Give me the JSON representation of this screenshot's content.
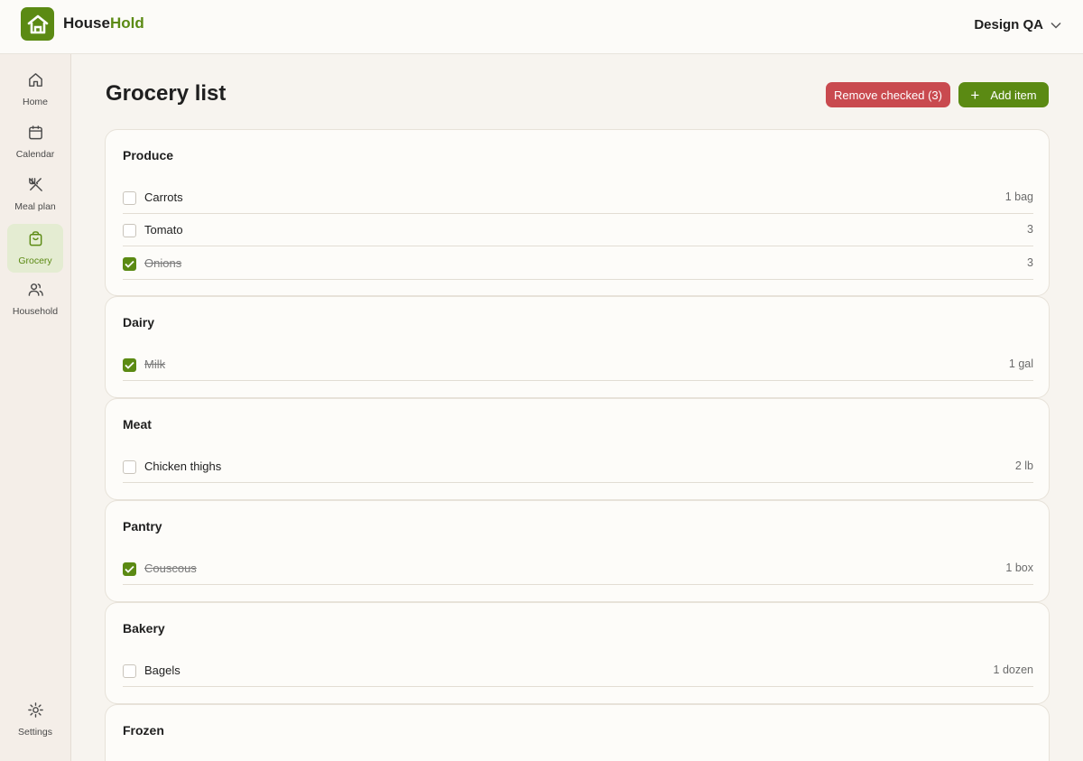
{
  "brand": {
    "name_part1": "House",
    "name_part2": "Hold"
  },
  "account": {
    "name": "Design QA"
  },
  "sidebar": {
    "items": [
      {
        "label": "Home",
        "icon": "home-icon"
      },
      {
        "label": "Calendar",
        "icon": "calendar-icon"
      },
      {
        "label": "Meal plan",
        "icon": "utensils-icon"
      },
      {
        "label": "Grocery",
        "icon": "shopping-bag-icon",
        "active": true
      },
      {
        "label": "Household",
        "icon": "users-icon"
      }
    ],
    "settings_label": "Settings"
  },
  "page": {
    "title": "Grocery list"
  },
  "actions": {
    "remove_checked": "Remove checked (3)",
    "add_item": "Add item"
  },
  "colors": {
    "accent": "#5b8a13",
    "danger": "#c94a4f",
    "active_bg": "#e4ecd2"
  },
  "categories": [
    {
      "name": "Produce",
      "items": [
        {
          "name": "Carrots",
          "qty": "1 bag",
          "checked": false
        },
        {
          "name": "Tomato",
          "qty": "3",
          "checked": false
        },
        {
          "name": "Onions",
          "qty": "3",
          "checked": true
        }
      ]
    },
    {
      "name": "Dairy",
      "items": [
        {
          "name": "Milk",
          "qty": "1 gal",
          "checked": true
        }
      ]
    },
    {
      "name": "Meat",
      "items": [
        {
          "name": "Chicken thighs",
          "qty": "2 lb",
          "checked": false
        }
      ]
    },
    {
      "name": "Pantry",
      "items": [
        {
          "name": "Couscous",
          "qty": "1 box",
          "checked": true
        }
      ]
    },
    {
      "name": "Bakery",
      "items": [
        {
          "name": "Bagels",
          "qty": "1 dozen",
          "checked": false
        }
      ]
    },
    {
      "name": "Frozen",
      "items": []
    }
  ]
}
